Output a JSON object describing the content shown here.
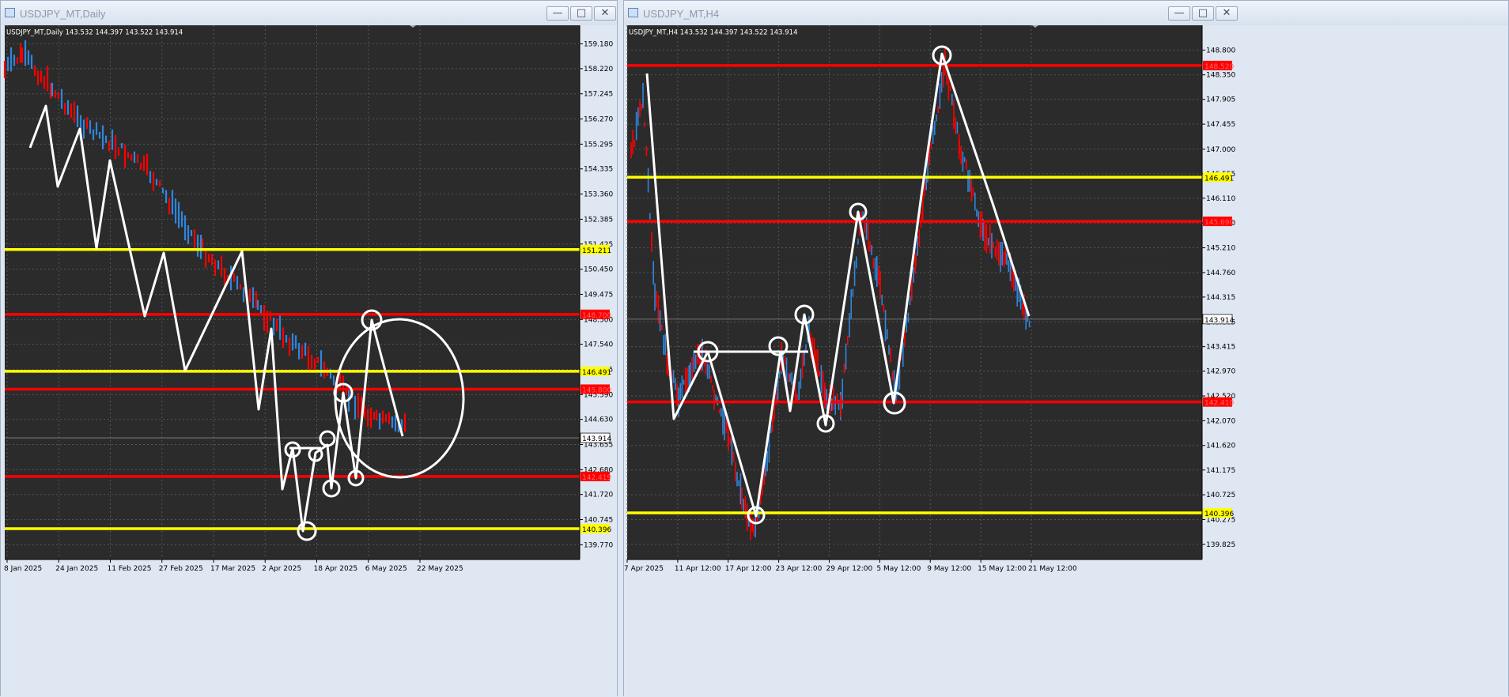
{
  "windows": [
    {
      "title": "USDJPY_MT,Daily",
      "header": "USDJPY_MT,Daily  143.532 144.397 143.522 143.914",
      "price_ticks": [
        "159.180",
        "158.220",
        "157.245",
        "156.270",
        "155.295",
        "154.335",
        "153.360",
        "152.385",
        "151.425",
        "150.450",
        "149.475",
        "148.500",
        "147.540",
        "146.565",
        "145.590",
        "144.630",
        "143.655",
        "142.680",
        "141.720",
        "140.745",
        "139.770"
      ],
      "price_axis": {
        "min": 139.2,
        "max": 159.9
      },
      "date_labels": [
        "8 Jan 2025",
        "24 Jan 2025",
        "11 Feb 2025",
        "27 Feb 2025",
        "17 Mar 2025",
        "2 Apr 2025",
        "18 Apr 2025",
        "6 May 2025",
        "22 May 2025"
      ],
      "current_price": "143.914",
      "hlines": [
        {
          "price": 151.211,
          "label": "151.211",
          "color": "#ffff00"
        },
        {
          "price": 148.7,
          "label": "148.700",
          "color": "#ff0000"
        },
        {
          "price": 146.491,
          "label": "146.491",
          "color": "#ffff00"
        },
        {
          "price": 145.8,
          "label": "145.800",
          "color": "#ff0000"
        },
        {
          "price": 142.419,
          "label": "142.419",
          "color": "#ff0000"
        },
        {
          "price": 140.396,
          "label": "140.396",
          "color": "#ffff00"
        }
      ]
    },
    {
      "title": "USDJPY_MT,H4",
      "header": "USDJPY_MT,H4  143.532 144.397 143.522 143.914",
      "price_ticks": [
        "148.800",
        "148.350",
        "147.905",
        "147.455",
        "147.000",
        "146.555",
        "146.110",
        "145.660",
        "145.210",
        "144.760",
        "144.315",
        "143.865",
        "143.415",
        "142.970",
        "142.520",
        "142.070",
        "141.620",
        "141.175",
        "140.725",
        "140.275",
        "139.825"
      ],
      "price_axis": {
        "min": 139.55,
        "max": 149.25
      },
      "date_labels": [
        "7 Apr 2025",
        "11 Apr 12:00",
        "17 Apr 12:00",
        "23 Apr 12:00",
        "29 Apr 12:00",
        "5 May 12:00",
        "9 May 12:00",
        "15 May 12:00",
        "21 May 12:00"
      ],
      "current_price": "143.914",
      "hlines": [
        {
          "price": 148.52,
          "label": "148.520",
          "color": "#ff0000"
        },
        {
          "price": 146.491,
          "label": "146.491",
          "color": "#ffff00"
        },
        {
          "price": 145.69,
          "label": "145.690",
          "color": "#ff0000"
        },
        {
          "price": 142.41,
          "label": "142.410",
          "color": "#ff0000"
        },
        {
          "price": 140.396,
          "label": "140.396",
          "color": "#ffff00"
        }
      ]
    }
  ],
  "colors": {
    "chart_bg": "#2b2b2b",
    "grid": "#555555",
    "bull": "#2e86de",
    "bear": "#ff0000",
    "drawing": "#ffffff",
    "support": "#ffff00",
    "resistance": "#ff0000"
  },
  "icons": {
    "minimize": "minimize-icon",
    "maximize": "maximize-icon",
    "close": "close-icon"
  }
}
